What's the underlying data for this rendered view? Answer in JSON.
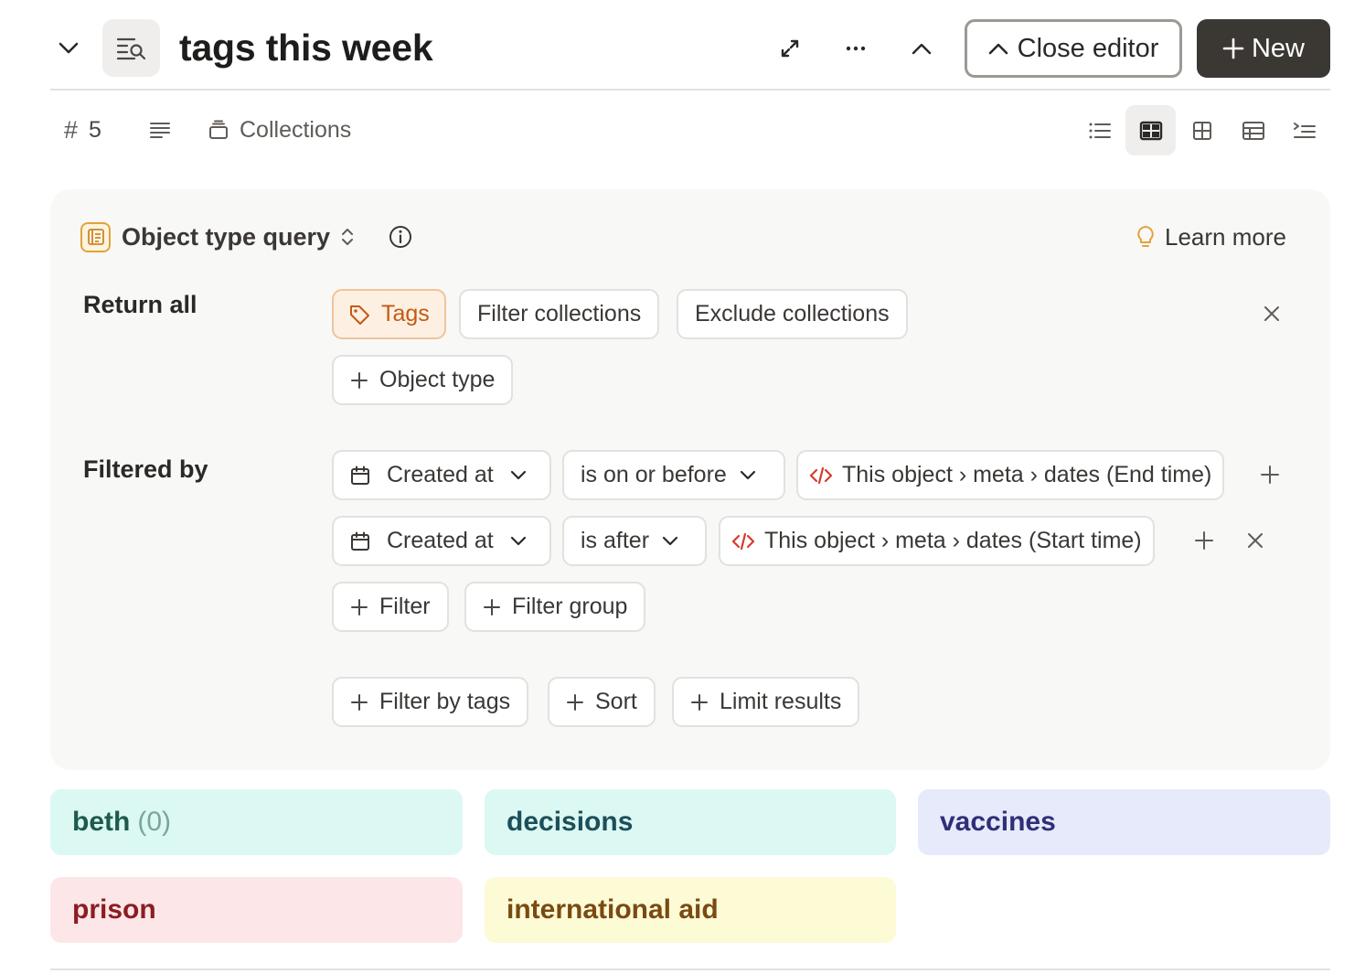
{
  "header": {
    "title": "tags this week",
    "close_editor_label": "Close editor",
    "new_label": "New",
    "icons": [
      "chevron-down-icon",
      "query-list-icon",
      "expand-icon",
      "more-icon",
      "chevron-up-icon"
    ]
  },
  "toolbar": {
    "count_symbol": "#",
    "count": "5",
    "collections_label": "Collections",
    "views": [
      {
        "name": "list-view",
        "active": false
      },
      {
        "name": "card-view",
        "active": true
      },
      {
        "name": "grid-view",
        "active": false
      },
      {
        "name": "table-view",
        "active": false
      },
      {
        "name": "outline-view",
        "active": false
      }
    ]
  },
  "query": {
    "type_label": "Object type query",
    "learn_more_label": "Learn more",
    "return_all_label": "Return all",
    "return_chips": {
      "tag": "Tags",
      "filter_collections": "Filter collections",
      "exclude_collections": "Exclude collections",
      "add_object_type": "Object type"
    },
    "filtered_by_label": "Filtered by",
    "filters": [
      {
        "field": "Created at",
        "operator": "is on or before",
        "value": "This object › meta › dates (End time)"
      },
      {
        "field": "Created at",
        "operator": "is after",
        "value": "This object › meta › dates (Start time)"
      }
    ],
    "add_filter_label": "Filter",
    "add_filter_group_label": "Filter group",
    "filter_by_tags_label": "Filter by tags",
    "sort_label": "Sort",
    "limit_results_label": "Limit results"
  },
  "results": [
    {
      "name": "beth",
      "count": "(0)",
      "bg": "#dcf8f3",
      "fg": "#1e5a4f",
      "count_color": "#7aa59c"
    },
    {
      "name": "decisions",
      "bg": "#dcf8f3",
      "fg": "#1c4f5a"
    },
    {
      "name": "vaccines",
      "bg": "#e6eafb",
      "fg": "#2f2f78"
    },
    {
      "name": "prison",
      "bg": "#fde6e8",
      "fg": "#8a1d22"
    },
    {
      "name": "international aid",
      "bg": "#fdfad6",
      "fg": "#7a4a12"
    }
  ],
  "colors": {
    "accent_dark": "#3b3834",
    "tag_orange": "#c45a14",
    "code_red": "#d83a2c",
    "panel_bg": "#f8f8f7"
  }
}
